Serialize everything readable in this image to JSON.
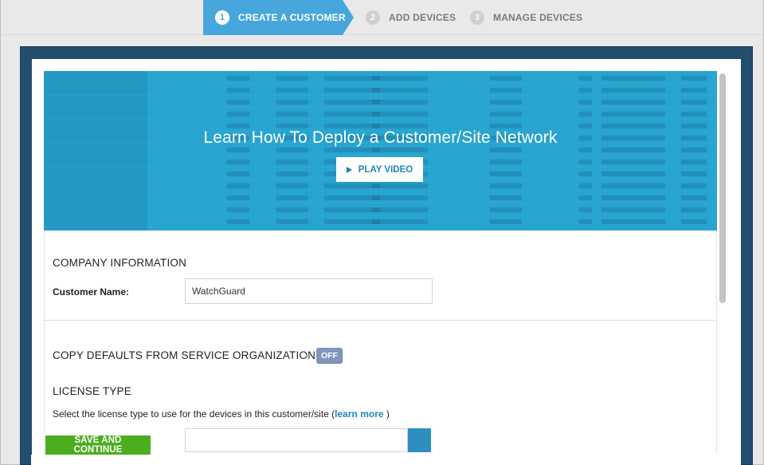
{
  "wizard": {
    "steps": [
      {
        "number": "1",
        "label": "CREATE A CUSTOMER",
        "active": true
      },
      {
        "number": "2",
        "label": "ADD DEVICES",
        "active": false
      },
      {
        "number": "3",
        "label": "MANAGE DEVICES",
        "active": false
      }
    ]
  },
  "banner": {
    "title": "Learn How To Deploy a Customer/Site Network",
    "play_label": "PLAY VIDEO",
    "play_icon": "play-icon"
  },
  "company": {
    "heading": "COMPANY INFORMATION",
    "customer_name_label": "Customer Name:",
    "customer_name_value": "WatchGuard"
  },
  "defaults": {
    "heading": "COPY DEFAULTS FROM SERVICE ORGANIZATION",
    "toggle_state": "OFF"
  },
  "license": {
    "heading": "LICENSE TYPE",
    "help_prefix": "Select the license type to use for the devices in this customer/site (",
    "help_link": "learn more",
    "help_suffix": " )"
  },
  "actions": {
    "save_label": "SAVE AND CONTINUE"
  },
  "colors": {
    "accent": "#47a7dd",
    "banner": "#27a4cf",
    "frame": "#244e6e",
    "save": "#4cae1f",
    "toggle": "#7f96bd",
    "link": "#1c87b9"
  }
}
